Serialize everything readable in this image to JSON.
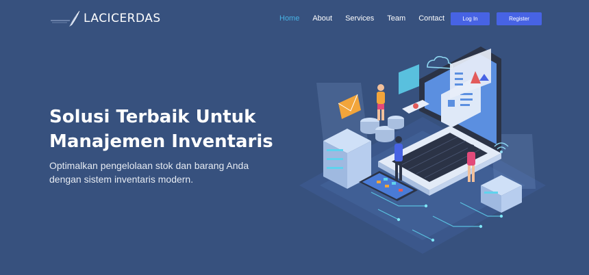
{
  "brand": {
    "name": "LACICERDAS",
    "logo_icon": "quill-pen-logo"
  },
  "nav": {
    "links": [
      {
        "label": "Home",
        "active": true
      },
      {
        "label": "About",
        "active": false
      },
      {
        "label": "Services",
        "active": false
      },
      {
        "label": "Team",
        "active": false
      },
      {
        "label": "Contact",
        "active": false
      }
    ],
    "login_label": "Log In",
    "register_label": "Register"
  },
  "hero": {
    "title_line1": "Solusi Terbaik Untuk",
    "title_line2": "Manajemen Inventaris",
    "subtitle_line1": "Optimalkan pengelolaan stok dan barang Anda",
    "subtitle_line2": "dengan sistem inventaris modern."
  },
  "illustration": {
    "icon": "isometric-inventory-technology-illustration"
  },
  "colors": {
    "background": "#37517e",
    "accent": "#47b2e4",
    "button": "#4763e4",
    "text": "#ffffff"
  }
}
